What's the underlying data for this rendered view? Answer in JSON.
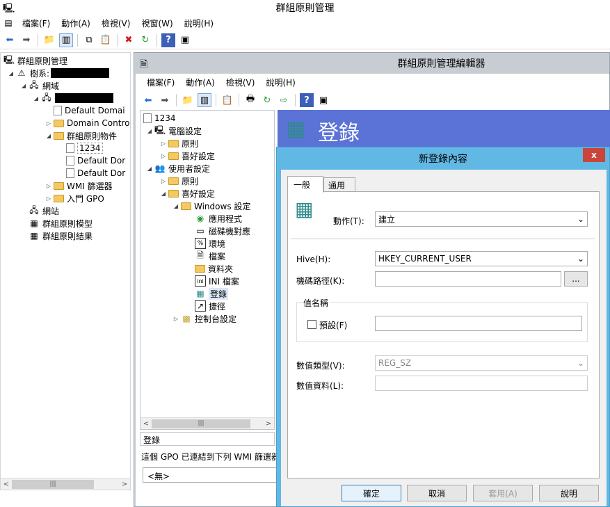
{
  "main": {
    "title": "群組原則管理",
    "menu": [
      "檔案(F)",
      "動作(A)",
      "檢視(V)",
      "視窗(W)",
      "說明(H)"
    ],
    "tree": [
      {
        "label": "群組原則管理"
      },
      {
        "label": "樹系:"
      },
      {
        "label": "網域"
      },
      {
        "label": "Default Domai"
      },
      {
        "label": "Domain Contro"
      },
      {
        "label": "群組原則物件"
      },
      {
        "label": "1234"
      },
      {
        "label": "Default Dor"
      },
      {
        "label": "Default Dor"
      },
      {
        "label": "WMI 篩選器"
      },
      {
        "label": "入門 GPO"
      },
      {
        "label": "網站"
      },
      {
        "label": "群組原則模型"
      },
      {
        "label": "群組原則結果"
      }
    ]
  },
  "editor": {
    "title": "群組原則管理編輯器",
    "menu": [
      "檔案(F)",
      "動作(A)",
      "檢視(V)",
      "說明(H)"
    ],
    "tree": [
      {
        "label": "1234"
      },
      {
        "label": "電腦設定"
      },
      {
        "label": "原則"
      },
      {
        "label": "喜好設定"
      },
      {
        "label": "使用者設定"
      },
      {
        "label": "原則"
      },
      {
        "label": "喜好設定"
      },
      {
        "label": "Windows 設定"
      },
      {
        "label": "應用程式"
      },
      {
        "label": "磁碟機對應"
      },
      {
        "label": "環境"
      },
      {
        "label": "檔案"
      },
      {
        "label": "資料夾"
      },
      {
        "label": "INI 檔案"
      },
      {
        "label": "登錄"
      },
      {
        "label": "捷徑"
      },
      {
        "label": "控制台設定"
      }
    ],
    "status": "登錄",
    "wmi_text": "這個 GPO 已連結到下列 WMI 篩選器",
    "wmi_value": "<無>",
    "banner_title": "登錄"
  },
  "dialog": {
    "title": "新登錄內容",
    "close": "x",
    "tabs": [
      "一般",
      "通用"
    ],
    "action_label": "動作(T):",
    "action_value": "建立",
    "hive_label": "Hive(H):",
    "hive_value": "HKEY_CURRENT_USER",
    "keypath_label": "機碼路徑(K):",
    "keypath_value": "",
    "browse": "...",
    "value_name_group": "值名稱",
    "default_label": "預設(F)",
    "value_name_value": "",
    "value_type_label": "數值類型(V):",
    "value_type_value": "REG_SZ",
    "value_data_label": "數值資料(L):",
    "value_data_value": "",
    "buttons": {
      "ok": "確定",
      "cancel": "取消",
      "apply": "套用(A)",
      "help": "說明"
    }
  },
  "colors": {
    "accent": "#3c7fb1",
    "banner": "#5b73d6",
    "dialog_frame": "#62b8e4",
    "close": "#c9443a"
  }
}
